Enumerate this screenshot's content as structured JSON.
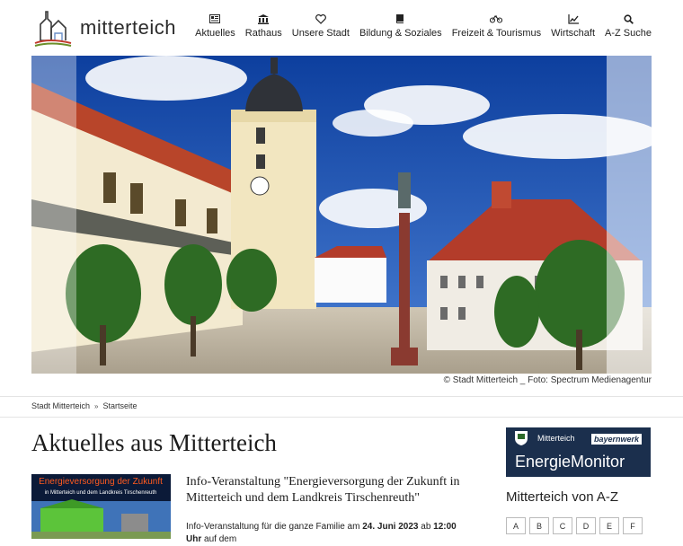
{
  "site": {
    "name": "mitterteich"
  },
  "nav": [
    {
      "label": "Aktuelles",
      "icon": "newspaper-icon"
    },
    {
      "label": "Rathaus",
      "icon": "building-columns-icon"
    },
    {
      "label": "Unsere Stadt",
      "icon": "heart-icon"
    },
    {
      "label": "Bildung & Soziales",
      "icon": "book-icon"
    },
    {
      "label": "Freizeit & Tourismus",
      "icon": "bicycle-icon"
    },
    {
      "label": "Wirtschaft",
      "icon": "line-chart-icon"
    },
    {
      "label": "A-Z Suche",
      "icon": "search-icon"
    }
  ],
  "hero": {
    "credit": "© Stadt Mitterteich _ Foto: Spectrum Medienagentur"
  },
  "breadcrumb": {
    "items": [
      "Stadt Mitterteich",
      "Startseite"
    ],
    "separator": "»"
  },
  "main": {
    "heading": "Aktuelles aus Mitterteich",
    "news": {
      "title": "Info-Veranstaltung \"Energieversorgung der Zukunft in Mitterteich und dem Landkreis Tirschenreuth\"",
      "teaser_prefix": "Info-Veranstaltung für die ganze Familie am ",
      "teaser_date": "24. Juni 2023",
      "teaser_mid": " ab ",
      "teaser_time": "12:00 Uhr",
      "teaser_suffix": " auf dem",
      "thumb_title": "Energieversorgung der Zukunft",
      "thumb_subtitle": "in Mitterteich und dem Landkreis Tirschenreuth"
    }
  },
  "sidebar": {
    "energie": {
      "town": "Mitterteich",
      "brand": "bayernwerk",
      "title": "EnergieMonitor"
    },
    "az_title": "Mitterteich von A-Z",
    "letters": [
      "A",
      "B",
      "C",
      "D",
      "E",
      "F"
    ]
  },
  "colors": {
    "energie_bg": "#1b2f4d",
    "thumb_title": "#ff5a1f"
  }
}
